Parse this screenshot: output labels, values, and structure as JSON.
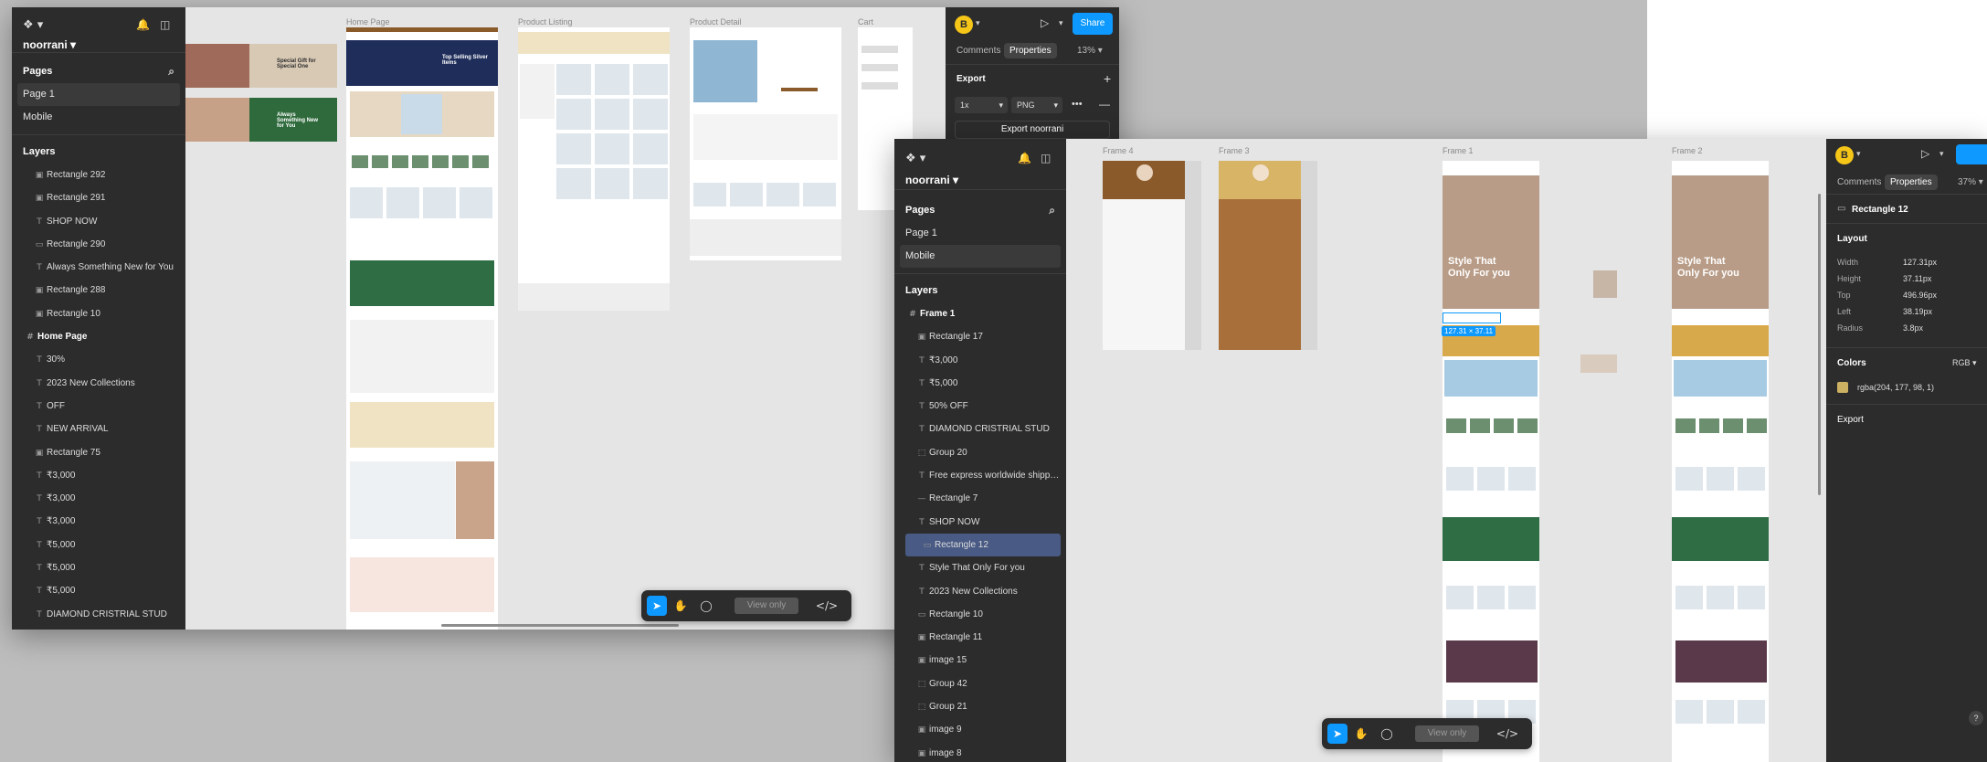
{
  "window1": {
    "project": "noorrani",
    "pages_heading": "Pages",
    "pages": [
      "Page 1",
      "Mobile"
    ],
    "selected_page": 0,
    "layers_heading": "Layers",
    "layers": [
      {
        "icon": "image",
        "label": "Rectangle 292"
      },
      {
        "icon": "image",
        "label": "Rectangle 291"
      },
      {
        "icon": "text",
        "label": "SHOP NOW"
      },
      {
        "icon": "rect",
        "label": "Rectangle 290"
      },
      {
        "icon": "text",
        "label": "Always Something New for You"
      },
      {
        "icon": "image",
        "label": "Rectangle 288"
      },
      {
        "icon": "image",
        "label": "Rectangle 10"
      },
      {
        "icon": "frame",
        "label": "Home Page"
      },
      {
        "icon": "text",
        "label": "30%"
      },
      {
        "icon": "text",
        "label": "2023 New Collections"
      },
      {
        "icon": "text",
        "label": "OFF"
      },
      {
        "icon": "text",
        "label": "NEW ARRIVAL"
      },
      {
        "icon": "image",
        "label": "Rectangle 75"
      },
      {
        "icon": "text",
        "label": "₹3,000"
      },
      {
        "icon": "text",
        "label": "₹3,000"
      },
      {
        "icon": "text",
        "label": "₹3,000"
      },
      {
        "icon": "text",
        "label": "₹5,000"
      },
      {
        "icon": "text",
        "label": "₹5,000"
      },
      {
        "icon": "text",
        "label": "₹5,000"
      },
      {
        "icon": "text",
        "label": "DIAMOND CRISTRIAL STUD"
      }
    ],
    "frame_labels": [
      "Home Page",
      "Product Listing",
      "Product Detail",
      "Cart"
    ],
    "banners": [
      "Special Gift for Special One",
      "Always Something New for You"
    ],
    "hero_text": "Top Selling Silver Items",
    "panel": {
      "avatar": "B",
      "share": "Share",
      "tabs": [
        "Comments",
        "Properties"
      ],
      "active_tab": 1,
      "zoom": "13%",
      "export_heading": "Export",
      "scale": "1x",
      "format": "PNG",
      "export_button": "Export noorrani"
    },
    "toolbar": {
      "view_only": "View only"
    }
  },
  "window2": {
    "project": "noorrani",
    "pages_heading": "Pages",
    "pages": [
      "Page 1",
      "Mobile"
    ],
    "selected_page": 1,
    "layers_heading": "Layers",
    "layers": [
      {
        "icon": "frame",
        "label": "Frame 1"
      },
      {
        "icon": "image",
        "label": "Rectangle 17"
      },
      {
        "icon": "text",
        "label": "₹3,000"
      },
      {
        "icon": "text",
        "label": "₹5,000"
      },
      {
        "icon": "text",
        "label": "50% OFF"
      },
      {
        "icon": "text",
        "label": "DIAMOND CRISTRIAL STUD"
      },
      {
        "icon": "group",
        "label": "Group 20"
      },
      {
        "icon": "text",
        "label": "Free express worldwide shipping"
      },
      {
        "icon": "line",
        "label": "Rectangle 7"
      },
      {
        "icon": "text",
        "label": "SHOP NOW"
      },
      {
        "icon": "rect",
        "label": "Rectangle 12"
      },
      {
        "icon": "text",
        "label": "Style That Only For you"
      },
      {
        "icon": "text",
        "label": "2023 New Collections"
      },
      {
        "icon": "rect",
        "label": "Rectangle 10"
      },
      {
        "icon": "image",
        "label": "Rectangle 11"
      },
      {
        "icon": "image",
        "label": "image 15"
      },
      {
        "icon": "group",
        "label": "Group 42"
      },
      {
        "icon": "group",
        "label": "Group 21"
      },
      {
        "icon": "image",
        "label": "image 9"
      },
      {
        "icon": "image",
        "label": "image 8"
      }
    ],
    "highlighted_layer": 10,
    "frame_labels": [
      "Frame 4",
      "Frame 3",
      "Frame 1",
      "Frame 2"
    ],
    "hero_text": "Style That Only For you",
    "selection_badge": {
      "w": "127.31",
      "h": "37.11"
    },
    "panel": {
      "avatar": "B",
      "tabs": [
        "Comments",
        "Properties"
      ],
      "active_tab": 1,
      "zoom": "37%",
      "selected_name": "Rectangle 12",
      "layout_heading": "Layout",
      "props": [
        {
          "key": "Width",
          "value": "127.31px"
        },
        {
          "key": "Height",
          "value": "37.11px"
        },
        {
          "key": "Top",
          "value": "496.96px"
        },
        {
          "key": "Left",
          "value": "38.19px"
        },
        {
          "key": "Radius",
          "value": "3.8px"
        }
      ],
      "colors_heading": "Colors",
      "color_mode": "RGB",
      "color_value": "rgba(204, 177, 98, 1)",
      "color_swatch": "#ccb162",
      "export_heading": "Export",
      "help": "?"
    },
    "toolbar": {
      "view_only": "View only"
    }
  },
  "colors": {
    "panel_bg": "#2c2c2c",
    "accent": "#0d99ff",
    "highlight": "#495a84",
    "brand_brown": "#8a5a2b",
    "brand_gold": "#c9a24a"
  }
}
